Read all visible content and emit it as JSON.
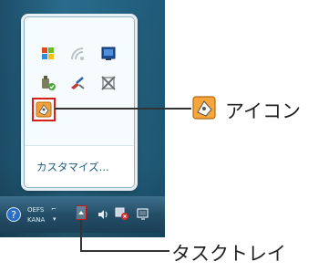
{
  "popup": {
    "customize_link": "カスタマイズ..."
  },
  "callout": {
    "icon_label": "アイコン",
    "tray_label": "タスクトレイ"
  },
  "taskbar": {
    "language_top": "OEFS",
    "language_bottom": "KANA",
    "kbd_symbol_top": "⌐",
    "kbd_symbol_bottom": "▾"
  },
  "icons": {
    "row1": [
      "windows-flag-icon",
      "wireless-icon",
      "display-icon"
    ],
    "row2": [
      "device-icon",
      "tool-icon",
      "disabled-icon"
    ],
    "highlighted": "app-icon",
    "tray": [
      "help-icon",
      "show-hidden-icon",
      "volume-icon",
      "network-icon",
      "power-icon"
    ]
  },
  "colors": {
    "highlight": "#d51e1e",
    "link": "#1a5b86",
    "background_dark": "#1f5a78"
  }
}
